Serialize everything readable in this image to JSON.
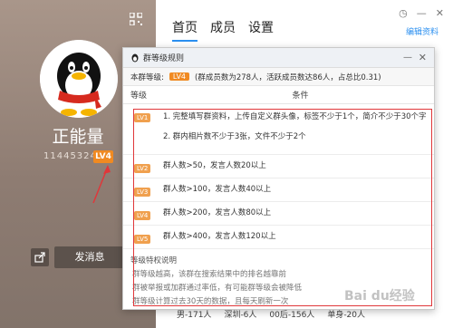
{
  "profile": {
    "name": "正能量",
    "uid": "11445324",
    "level_badge": "LV4",
    "send_label": "发消息"
  },
  "tabs": [
    {
      "label": "首页",
      "active": true
    },
    {
      "label": "成员",
      "active": false
    },
    {
      "label": "设置",
      "active": false
    }
  ],
  "edit_link": "编辑资料",
  "background_stats": [
    "男-171人",
    "深圳-6人",
    "00后-156人",
    "单身-20人"
  ],
  "dialog": {
    "title": "群等级规则",
    "current_label": "本群等级:",
    "current_level": "LV4",
    "current_info": "(群成员数为278人，活跃成员数达86人，占总比0.31)",
    "col_level": "等级",
    "col_condition": "条件",
    "rows": [
      {
        "level": "LV1",
        "lines": [
          "1. 完整填写群资料，上传自定义群头像，标签不少于1个，简介不少于30个字",
          "2. 群内相片数不少于3张，文件不少于2个"
        ]
      },
      {
        "level": "LV2",
        "lines": [
          "群人数>50，发言人数20以上"
        ]
      },
      {
        "level": "LV3",
        "lines": [
          "群人数>100，发言人数40以上"
        ]
      },
      {
        "level": "LV4",
        "lines": [
          "群人数>200，发言人数80以上"
        ]
      },
      {
        "level": "LV5",
        "lines": [
          "群人数>400，发言人数120以上"
        ]
      }
    ],
    "privilege_title": "等级特权说明",
    "privilege_lines": [
      "群等级越高，该群在搜索结果中的排名越靠前",
      "群被举报或加群通过率低，有可能群等级会被降低",
      "群等级计算过去30天的数据，且每天刷新一次"
    ]
  },
  "watermark": "Bai du经验",
  "colors": {
    "accent": "#2a8ff0",
    "badge": "#f08a21",
    "highlight": "#e0373a"
  }
}
